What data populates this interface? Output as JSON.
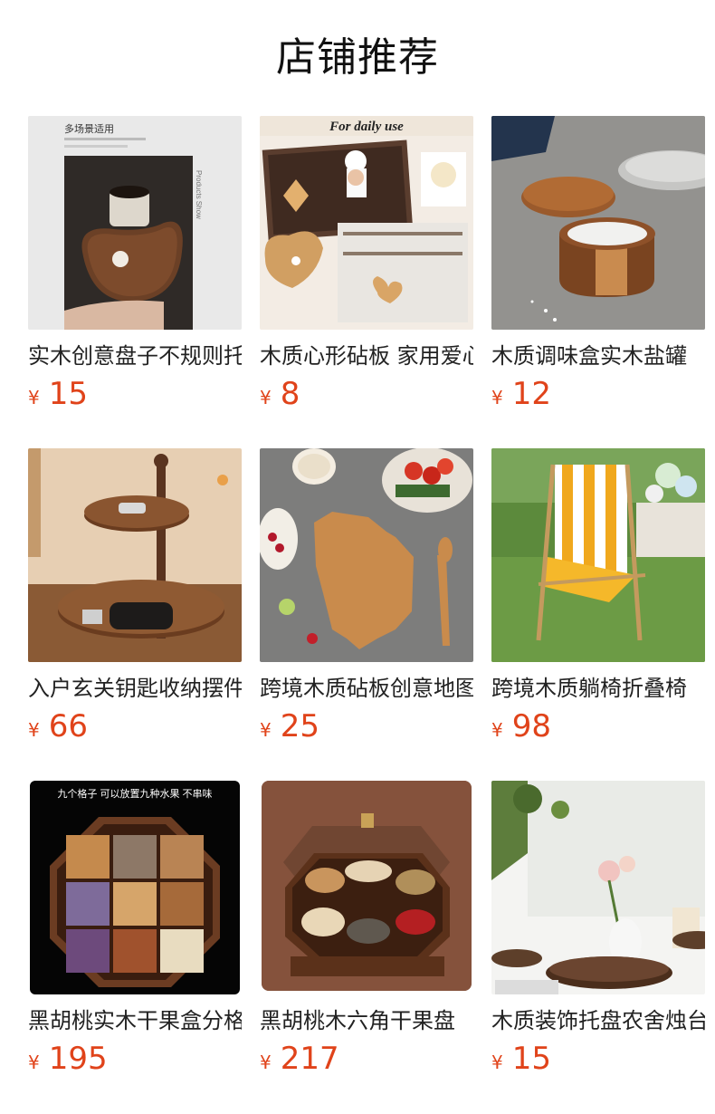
{
  "page": {
    "title": "店铺推荐"
  },
  "currency_symbol": "¥",
  "products": [
    {
      "name": "实木创意盘子不规则托盘",
      "price": "15",
      "image_text": [
        "多场景适用",
        "Products Show"
      ]
    },
    {
      "name": "木质心形砧板 家用爱心菜板",
      "price": "8",
      "image_text": [
        "For daily use"
      ]
    },
    {
      "name": "木质调味盒实木盐罐",
      "price": "12",
      "image_text": []
    },
    {
      "name": "入户玄关钥匙收纳摆件",
      "price": "66",
      "image_text": []
    },
    {
      "name": "跨境木质砧板创意地图",
      "price": "25",
      "image_text": []
    },
    {
      "name": "跨境木质躺椅折叠椅",
      "price": "98",
      "image_text": []
    },
    {
      "name": "黑胡桃实木干果盒分格",
      "price": "195",
      "image_text": [
        "九个格子 可以放置九种水果 不串味"
      ]
    },
    {
      "name": "黑胡桃木六角干果盘",
      "price": "217",
      "image_text": []
    },
    {
      "name": "木质装饰托盘农舍烛台",
      "price": "15",
      "image_text": []
    }
  ]
}
